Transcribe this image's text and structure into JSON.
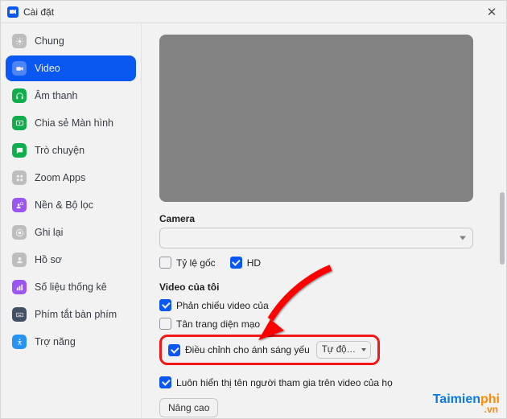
{
  "window": {
    "title": "Cài đặt"
  },
  "sidebar": {
    "items": [
      {
        "label": "Chung"
      },
      {
        "label": "Video"
      },
      {
        "label": "Âm thanh"
      },
      {
        "label": "Chia sẻ Màn hình"
      },
      {
        "label": "Trò chuyện"
      },
      {
        "label": "Zoom Apps"
      },
      {
        "label": "Nền & Bộ lọc"
      },
      {
        "label": "Ghi lại"
      },
      {
        "label": "Hồ sơ"
      },
      {
        "label": "Số liệu thống kê"
      },
      {
        "label": "Phím tắt bàn phím"
      },
      {
        "label": "Trợ năng"
      }
    ]
  },
  "content": {
    "camera_label": "Camera",
    "ratio_label": "Tỷ lệ gốc",
    "hd_label": "HD",
    "myvideo_label": "Video của tôi",
    "mirror_label": "Phản chiếu video của",
    "touchup_label": "Tân trang diện mạo",
    "lowlight_label": "Điều chỉnh cho ánh sáng yếu",
    "lowlight_mode": "Tự độ…",
    "alwaysname_label": "Luôn hiển thị tên người tham gia trên video của họ",
    "advanced_label": "Nâng cao"
  },
  "watermark": {
    "brand1": "Taimien",
    "brand2": "phi",
    "tld": ".vn"
  }
}
